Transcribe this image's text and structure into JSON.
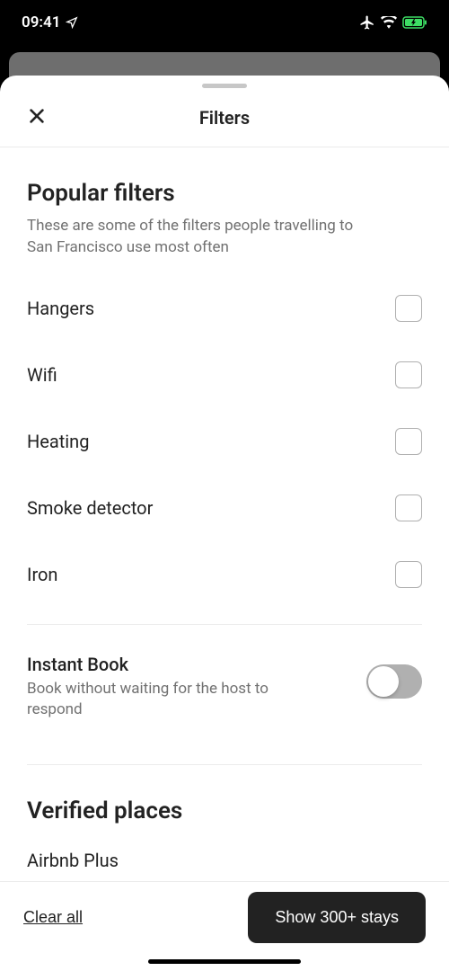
{
  "status": {
    "time": "09:41"
  },
  "header": {
    "title": "Filters"
  },
  "popular": {
    "title": "Popular filters",
    "subtitle": "These are some of the filters people travelling to San Francisco use most often",
    "items": [
      {
        "label": "Hangers"
      },
      {
        "label": "Wifi"
      },
      {
        "label": "Heating"
      },
      {
        "label": "Smoke detector"
      },
      {
        "label": "Iron"
      }
    ]
  },
  "instant": {
    "title": "Instant Book",
    "subtitle": "Book without waiting for the host to respond"
  },
  "verified": {
    "title": "Verified places",
    "items": [
      {
        "label": "Airbnb Plus"
      }
    ]
  },
  "footer": {
    "clear": "Clear all",
    "show": "Show 300+ stays"
  }
}
